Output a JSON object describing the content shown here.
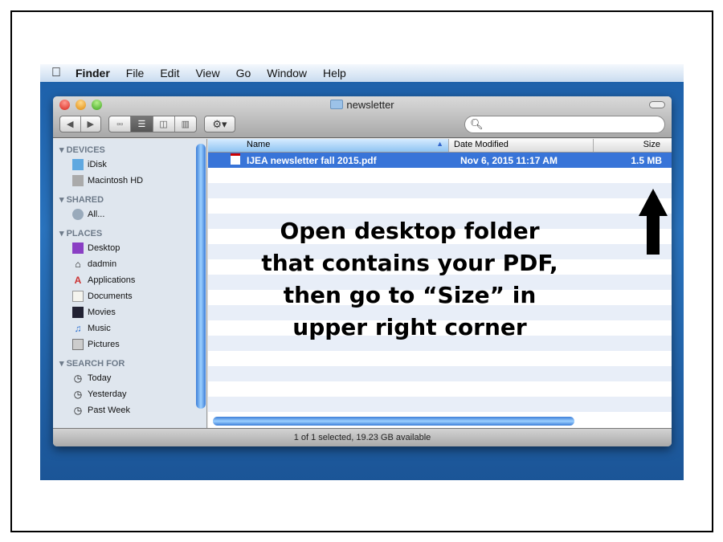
{
  "menubar": {
    "app": "Finder",
    "items": [
      "File",
      "Edit",
      "View",
      "Go",
      "Window",
      "Help"
    ]
  },
  "window": {
    "title": "newsletter",
    "search_placeholder": ""
  },
  "sidebar": {
    "sections": [
      {
        "label": "DEVICES",
        "items": [
          {
            "label": "iDisk",
            "icon": "idisk-icon"
          },
          {
            "label": "Macintosh HD",
            "icon": "hard-drive-icon"
          }
        ]
      },
      {
        "label": "SHARED",
        "items": [
          {
            "label": "All...",
            "icon": "network-icon"
          }
        ]
      },
      {
        "label": "PLACES",
        "items": [
          {
            "label": "Desktop",
            "icon": "desktop-icon"
          },
          {
            "label": "dadmin",
            "icon": "home-icon"
          },
          {
            "label": "Applications",
            "icon": "applications-icon"
          },
          {
            "label": "Documents",
            "icon": "documents-icon"
          },
          {
            "label": "Movies",
            "icon": "movies-icon"
          },
          {
            "label": "Music",
            "icon": "music-icon"
          },
          {
            "label": "Pictures",
            "icon": "pictures-icon"
          }
        ]
      },
      {
        "label": "SEARCH FOR",
        "items": [
          {
            "label": "Today",
            "icon": "clock-icon"
          },
          {
            "label": "Yesterday",
            "icon": "clock-icon"
          },
          {
            "label": "Past Week",
            "icon": "clock-icon"
          }
        ]
      }
    ]
  },
  "columns": {
    "name": "Name",
    "date": "Date Modified",
    "size": "Size"
  },
  "files": [
    {
      "name": "IJEA newsletter fall 2015.pdf",
      "date": "Nov 6, 2015 11:17 AM",
      "size": "1.5 MB",
      "selected": true
    }
  ],
  "status": "1 of 1 selected, 19.23 GB available",
  "annotation": [
    "Open desktop folder",
    "that contains your PDF,",
    "then go to “Size” in",
    "upper right corner"
  ],
  "colors": {
    "selection": "#3874d8",
    "desktop": "#2a74bf"
  }
}
